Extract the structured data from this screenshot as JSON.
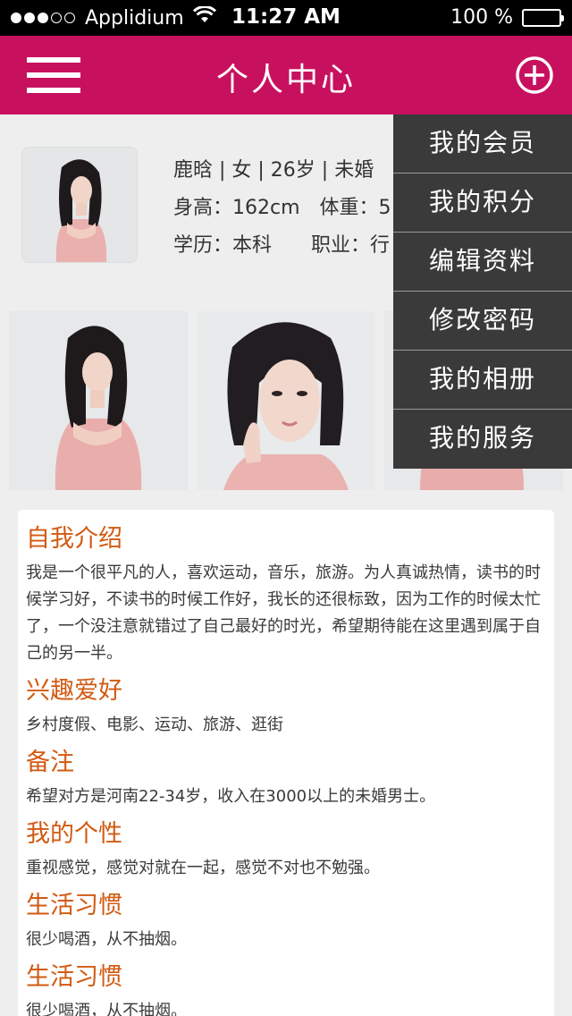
{
  "status_bar": {
    "carrier": "Applidium",
    "time": "11:27 AM",
    "battery": "100 %",
    "battery_level": 1.0,
    "signal_bars_filled": 3,
    "signal_bars_total": 5
  },
  "nav": {
    "title": "个人中心",
    "menu_icon": "hamburger-icon",
    "add_icon": "circle-plus-icon"
  },
  "profile": {
    "line1": "鹿晗 | 女 | 26岁 | 未婚",
    "height": "身高：162cm",
    "weight": "体重：5",
    "education": "学历：本科",
    "occupation": "职业：行"
  },
  "dropdown": {
    "items": [
      "我的会员",
      "我的积分",
      "编辑资料",
      "修改密码",
      "我的相册",
      "我的服务"
    ]
  },
  "sections": [
    {
      "title": "自我介绍",
      "body": "我是一个很平凡的人，喜欢运动，音乐，旅游。为人真诚热情，读书的时候学习好，不读书的时候工作好，我长的还很标致，因为工作的时候太忙了，一个没注意就错过了自己最好的时光，希望期待能在这里遇到属于自己的另一半。"
    },
    {
      "title": "兴趣爱好",
      "body": "乡村度假、电影、运动、旅游、逛街"
    },
    {
      "title": "备注",
      "body": "希望对方是河南22-34岁，收入在3000以上的未婚男士。"
    },
    {
      "title": "我的个性",
      "body": "重视感觉，感觉对就在一起，感觉不对也不勉强。"
    },
    {
      "title": "生活习惯",
      "body": "很少喝酒，从不抽烟。"
    },
    {
      "title": "生活习惯",
      "body": "很少喝酒，从不抽烟。"
    }
  ],
  "colors": {
    "brand": "#c8115e",
    "section_title": "#d25a12",
    "menu_bg": "#3a3a3a"
  }
}
